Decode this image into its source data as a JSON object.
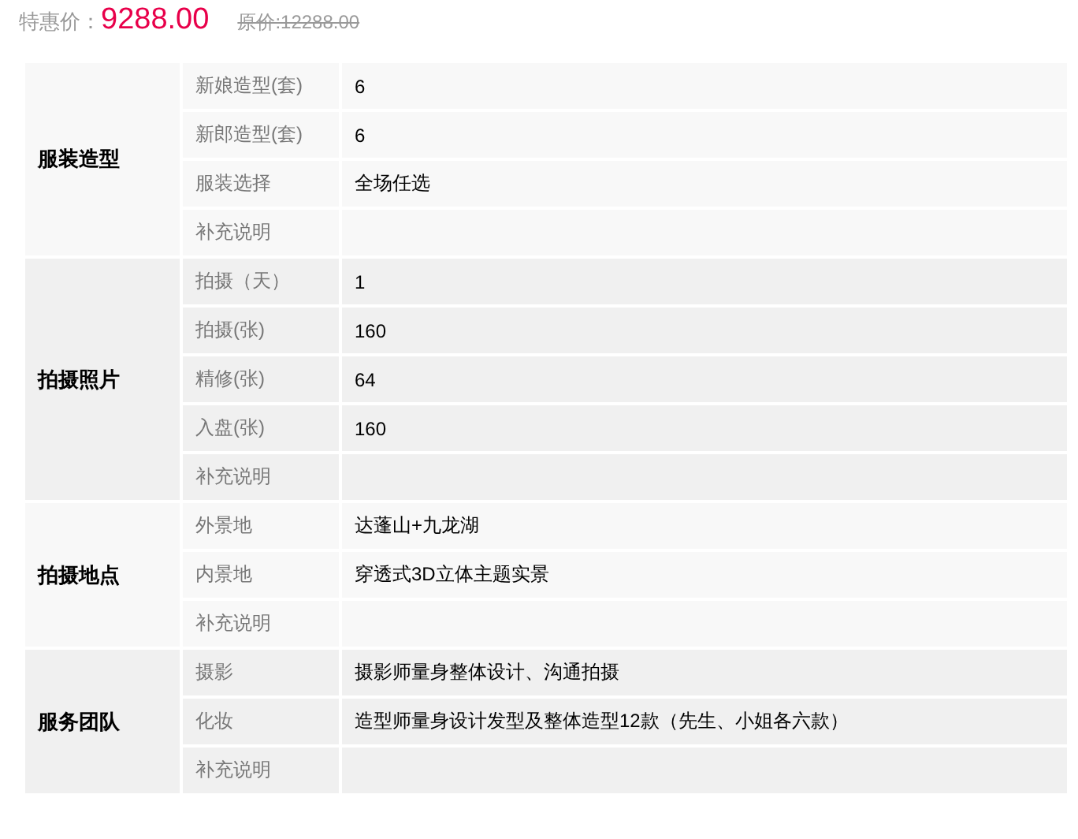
{
  "price": {
    "label": "特惠价：",
    "sale": "9288.00",
    "original": "原价:12288.00"
  },
  "groups": [
    {
      "title": "服装造型",
      "rows": [
        {
          "label": "新娘造型(套)",
          "value": "6"
        },
        {
          "label": "新郎造型(套)",
          "value": "6"
        },
        {
          "label": "服装选择",
          "value": "全场任选"
        },
        {
          "label": "补充说明",
          "value": ""
        }
      ]
    },
    {
      "title": "拍摄照片",
      "rows": [
        {
          "label": "拍摄（天）",
          "value": "1"
        },
        {
          "label": "拍摄(张)",
          "value": "160"
        },
        {
          "label": "精修(张)",
          "value": "64"
        },
        {
          "label": "入盘(张)",
          "value": "160"
        },
        {
          "label": "补充说明",
          "value": ""
        }
      ]
    },
    {
      "title": "拍摄地点",
      "rows": [
        {
          "label": "外景地",
          "value": "达蓬山+九龙湖"
        },
        {
          "label": "内景地",
          "value": "穿透式3D立体主题实景"
        },
        {
          "label": "补充说明",
          "value": ""
        }
      ]
    },
    {
      "title": "服务团队",
      "rows": [
        {
          "label": "摄影",
          "value": "摄影师量身整体设计、沟通拍摄"
        },
        {
          "label": "化妆",
          "value": "造型师量身设计发型及整体造型12款（先生、小姐各六款）"
        },
        {
          "label": "补充说明",
          "value": ""
        }
      ]
    }
  ]
}
